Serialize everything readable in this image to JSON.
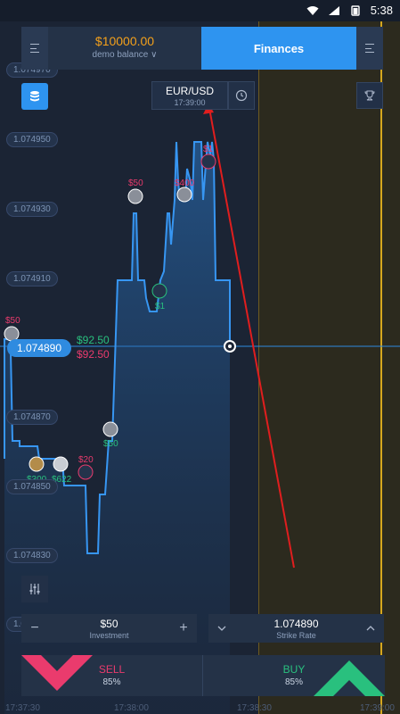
{
  "status_bar": {
    "time": "5:38"
  },
  "header": {
    "balance": "$10000.00",
    "balance_sub": "demo balance ∨",
    "finances_label": "Finances"
  },
  "asset": {
    "pair": "EUR/USD",
    "time": "17:39:00"
  },
  "price_axis": [
    "1.074970",
    "1.074950",
    "1.074930",
    "1.074910",
    "1.074870",
    "1.074850",
    "1.074830",
    "1.074810"
  ],
  "current_price": "1.074890",
  "profit": {
    "up": "$92.50",
    "down": "$92.50"
  },
  "trade_markers": [
    {
      "label": "$50",
      "color": "#ea3b6d"
    },
    {
      "label": "$50",
      "color": "#ea3b6d"
    },
    {
      "label": "$400",
      "color": "#ea3b6d"
    },
    {
      "label": "$1",
      "color": "#29c07e"
    },
    {
      "label": "$1",
      "color": "#ea3b6d"
    },
    {
      "label": "$50",
      "color": "#29c07e"
    },
    {
      "label": "$20",
      "color": "#ea3b6d"
    },
    {
      "label": "$300",
      "color": "#29c07e"
    },
    {
      "label": "$622",
      "color": "#29c07e"
    }
  ],
  "investment": {
    "value": "$50",
    "label": "Investment",
    "minus": "−",
    "plus": "+"
  },
  "strike": {
    "value": "1.074890",
    "label": "Strike Rate"
  },
  "sell": {
    "label": "SELL",
    "percent": "85%"
  },
  "buy": {
    "label": "BUY",
    "percent": "85%"
  },
  "time_axis": [
    "17:37:30",
    "17:38:00",
    "17:38:30",
    "17:39:00"
  ],
  "colors": {
    "accent": "#2e94f0",
    "balance": "#f3a01b",
    "sell": "#ea3b6d",
    "buy": "#29c07e",
    "expiry": "#d6a71e"
  }
}
